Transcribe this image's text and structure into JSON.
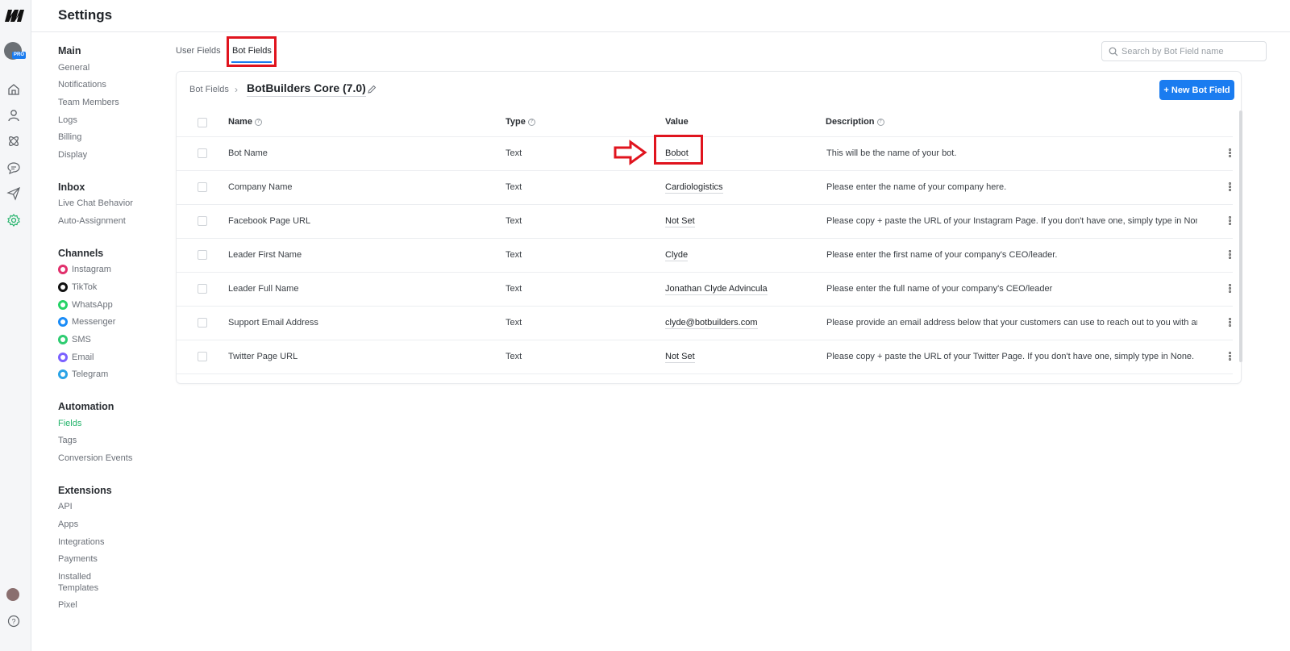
{
  "header": {
    "title": "Settings"
  },
  "rail": {
    "logo": "m-logo",
    "pro_badge": "PRO",
    "icons": [
      "home-icon",
      "contacts-icon",
      "flows-icon",
      "chat-icon",
      "broadcast-icon",
      "settings-icon"
    ]
  },
  "nav": {
    "main": {
      "title": "Main",
      "items": [
        "General",
        "Notifications",
        "Team Members",
        "Logs",
        "Billing",
        "Display"
      ]
    },
    "inbox": {
      "title": "Inbox",
      "items": [
        "Live Chat Behavior",
        "Auto-Assignment"
      ]
    },
    "channels": {
      "title": "Channels",
      "items": [
        {
          "label": "Instagram",
          "color": "#e1306c"
        },
        {
          "label": "TikTok",
          "color": "#111111"
        },
        {
          "label": "WhatsApp",
          "color": "#25d366"
        },
        {
          "label": "Messenger",
          "color": "#1a8cf7"
        },
        {
          "label": "SMS",
          "color": "#2ecc71"
        },
        {
          "label": "Email",
          "color": "#7b61ff"
        },
        {
          "label": "Telegram",
          "color": "#2aa3e6"
        }
      ]
    },
    "automation": {
      "title": "Automation",
      "items": [
        "Fields",
        "Tags",
        "Conversion Events"
      ]
    },
    "extensions": {
      "title": "Extensions",
      "items": [
        "API",
        "Apps",
        "Integrations",
        "Payments",
        "Installed",
        "Templates",
        "Pixel"
      ]
    }
  },
  "tabs": {
    "user_fields": "User Fields",
    "bot_fields": "Bot Fields"
  },
  "search": {
    "placeholder": "Search by Bot Field name"
  },
  "card": {
    "breadcrumb_root": "Bot Fields",
    "bot_name": "BotBuilders Core (7.0)",
    "new_button": "+ New Bot Field"
  },
  "table": {
    "headers": {
      "name": "Name",
      "type": "Type",
      "value": "Value",
      "description": "Description"
    },
    "rows": [
      {
        "name": "Bot Name",
        "type": "Text",
        "value": "Bobot",
        "description": "This will be the name of your bot."
      },
      {
        "name": "Company Name",
        "type": "Text",
        "value": "Cardiologistics",
        "description": "Please enter the name of your company here."
      },
      {
        "name": "Facebook Page URL",
        "type": "Text",
        "value": "Not Set",
        "description": "Please copy + paste the URL of your Instagram Page. If you don't have one, simply type in None."
      },
      {
        "name": "Leader First Name",
        "type": "Text",
        "value": "Clyde",
        "description": "Please enter the first name of your company's CEO/leader."
      },
      {
        "name": "Leader Full Name",
        "type": "Text",
        "value": "Jonathan Clyde Advincula",
        "description": "Please enter the full name of your company's CEO/leader"
      },
      {
        "name": "Support Email Address",
        "type": "Text",
        "value": "clyde@botbuilders.com",
        "description": "Please provide an email address below that your customers can use to reach out to you with any"
      },
      {
        "name": "Twitter Page URL",
        "type": "Text",
        "value": "Not Set",
        "description": "Please copy + paste the URL of your Twitter Page. If you don't have one, simply type in None."
      }
    ]
  },
  "colors": {
    "accent": "#1a7cf0",
    "active_nav": "#24b36b",
    "annotation": "#e0141e"
  }
}
